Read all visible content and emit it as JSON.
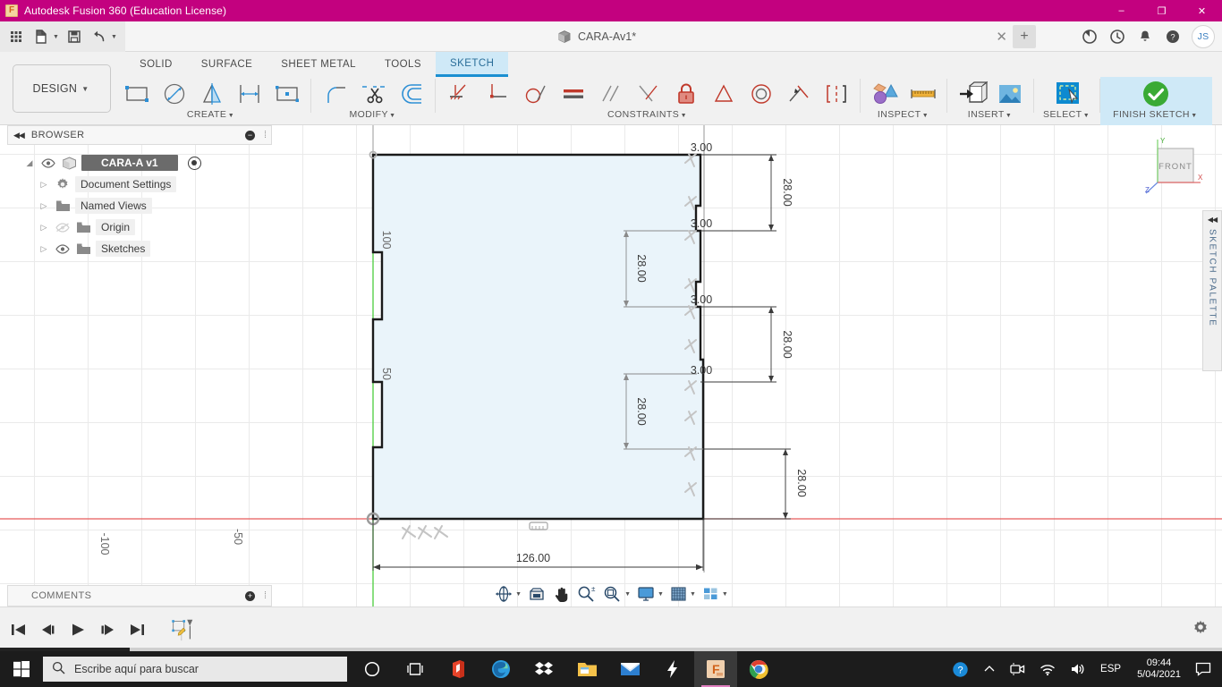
{
  "window": {
    "title": "Autodesk Fusion 360 (Education License)",
    "app_icon": "fusion-logo-icon",
    "minimize": "–",
    "maximize": "❐",
    "close": "✕"
  },
  "quick_access": {
    "items": [
      {
        "name": "app-grid-icon",
        "label": "Show Data Panel"
      },
      {
        "name": "new-file-icon",
        "label": "File"
      },
      {
        "name": "save-icon",
        "label": "Save"
      },
      {
        "name": "undo-icon",
        "label": "Undo"
      },
      {
        "name": "redo-icon",
        "label": "Redo"
      }
    ]
  },
  "document_tab": {
    "title": "CARA-Av1*",
    "close_label": "✕",
    "new_tab_label": "+"
  },
  "top_right_icons": [
    {
      "name": "job-status-icon"
    },
    {
      "name": "recent-activity-icon"
    },
    {
      "name": "notifications-bell-icon"
    },
    {
      "name": "help-icon"
    }
  ],
  "avatar": {
    "initials": "JS"
  },
  "workspace": {
    "label": "DESIGN",
    "caret": "▼"
  },
  "menu_tabs": [
    {
      "label": "SOLID",
      "active": false
    },
    {
      "label": "SURFACE",
      "active": false
    },
    {
      "label": "SHEET METAL",
      "active": false
    },
    {
      "label": "TOOLS",
      "active": false
    },
    {
      "label": "SKETCH",
      "active": true
    }
  ],
  "ribbon_groups": [
    {
      "label": "CREATE",
      "caret": "▼",
      "tools": [
        "rectangle-icon",
        "circle-diameter-icon",
        "mirror-icon",
        "dimension-icon",
        "rectangular-pattern-icon"
      ]
    },
    {
      "label": "MODIFY",
      "caret": "▼",
      "tools": [
        "fillet-icon",
        "trim-scissors-icon",
        "offset-icon"
      ]
    },
    {
      "label": "CONSTRAINTS",
      "caret": "▼",
      "tools": [
        "horizontal-vertical-constraint-icon",
        "coincident-constraint-icon",
        "tangent-constraint-icon",
        "equal-constraint-icon",
        "parallel-constraint-icon",
        "perpendicular-constraint-icon",
        "fix-lock-constraint-icon",
        "midpoint-constraint-icon",
        "concentric-constraint-icon",
        "collinear-constraint-icon",
        "symmetry-constraint-icon"
      ]
    },
    {
      "label": "INSPECT",
      "caret": "▼",
      "tools": [
        "section-analysis-icon",
        "measure-ruler-icon"
      ]
    },
    {
      "label": "INSERT",
      "caret": "▼",
      "tools": [
        "insert-derive-icon",
        "insert-image-icon"
      ]
    },
    {
      "label": "SELECT",
      "caret": "▼",
      "tools": [
        "select-window-cursor-icon"
      ]
    },
    {
      "label": "FINISH SKETCH",
      "caret": "▼",
      "tools": [
        "finish-sketch-check-icon"
      ]
    }
  ],
  "browser": {
    "header": "BROWSER",
    "collapse_icon": "◀◀",
    "minimize_icon": "−",
    "items": [
      {
        "label": "CARA-A v1",
        "icon": "component-cube-icon",
        "eye": true,
        "root": true,
        "radio": true
      },
      {
        "label": "Document Settings",
        "icon": "gear-icon",
        "eye": false,
        "arrow": "▷"
      },
      {
        "label": "Named Views",
        "icon": "folder-icon",
        "eye": false,
        "arrow": "▷"
      },
      {
        "label": "Origin",
        "icon": "folder-icon",
        "eye": true,
        "eye_off": true,
        "arrow": "▷"
      },
      {
        "label": "Sketches",
        "icon": "folder-icon",
        "eye": true,
        "arrow": "▷"
      }
    ]
  },
  "comments": {
    "label": "COMMENTS",
    "add_icon": "+"
  },
  "sketch_palette": {
    "label": "SKETCH PALETTE",
    "collapse_icon": "◀◀"
  },
  "view_cube": {
    "face": "FRONT",
    "axis_x": "X",
    "axis_y": "Y",
    "axis_z": "Z"
  },
  "canvas": {
    "axis_labels": [
      "-100",
      "-50"
    ],
    "dimensions": {
      "overall_width": "126.00",
      "right_segments": [
        "28.00",
        "28.00",
        "28.00"
      ],
      "inner_segments": [
        "28.00",
        "28.00"
      ],
      "notch_widths": [
        "3.00",
        "3.00",
        "3.00",
        "3.00"
      ]
    }
  },
  "nav_bar": {
    "buttons": [
      {
        "name": "orbit-icon",
        "caret": true
      },
      {
        "name": "look-at-icon",
        "caret": false
      },
      {
        "name": "pan-hand-icon",
        "caret": false
      },
      {
        "name": "zoom-icon",
        "caret": false
      },
      {
        "name": "zoom-window-icon",
        "caret": true
      },
      {
        "name": "display-settings-icon",
        "caret": true
      },
      {
        "name": "grid-snaps-icon",
        "caret": true
      },
      {
        "name": "viewports-icon",
        "caret": true
      }
    ]
  },
  "timeline": {
    "controls": [
      {
        "name": "go-to-beginning-icon",
        "glyph": "⏮"
      },
      {
        "name": "step-back-icon",
        "glyph": "◀"
      },
      {
        "name": "play-icon",
        "glyph": "▶"
      },
      {
        "name": "step-forward-icon",
        "glyph": "▶"
      },
      {
        "name": "go-to-end-icon",
        "glyph": "⏭"
      }
    ],
    "feature": {
      "name": "sketch-feature-icon"
    },
    "settings_icon": "gear-icon"
  },
  "taskbar": {
    "start_icon": "windows-start-icon",
    "search_placeholder": "Escribe aquí para buscar",
    "search_icon": "search-icon",
    "apps": [
      {
        "name": "cortana-icon"
      },
      {
        "name": "task-view-icon"
      },
      {
        "name": "office-icon"
      },
      {
        "name": "edge-icon"
      },
      {
        "name": "dropbox-icon"
      },
      {
        "name": "file-explorer-icon"
      },
      {
        "name": "mail-icon"
      },
      {
        "name": "lightning-icon"
      },
      {
        "name": "fusion360-icon",
        "active": true
      },
      {
        "name": "chrome-icon"
      }
    ],
    "tray": [
      {
        "name": "windows-help-icon"
      },
      {
        "name": "show-hidden-icons-chevron",
        "glyph": "∧"
      },
      {
        "name": "webcam-icon"
      },
      {
        "name": "wifi-icon"
      },
      {
        "name": "volume-icon"
      }
    ],
    "language": "ESP",
    "time": "09:44",
    "date": "5/04/2021",
    "notification_icon": "notification-center-icon"
  }
}
